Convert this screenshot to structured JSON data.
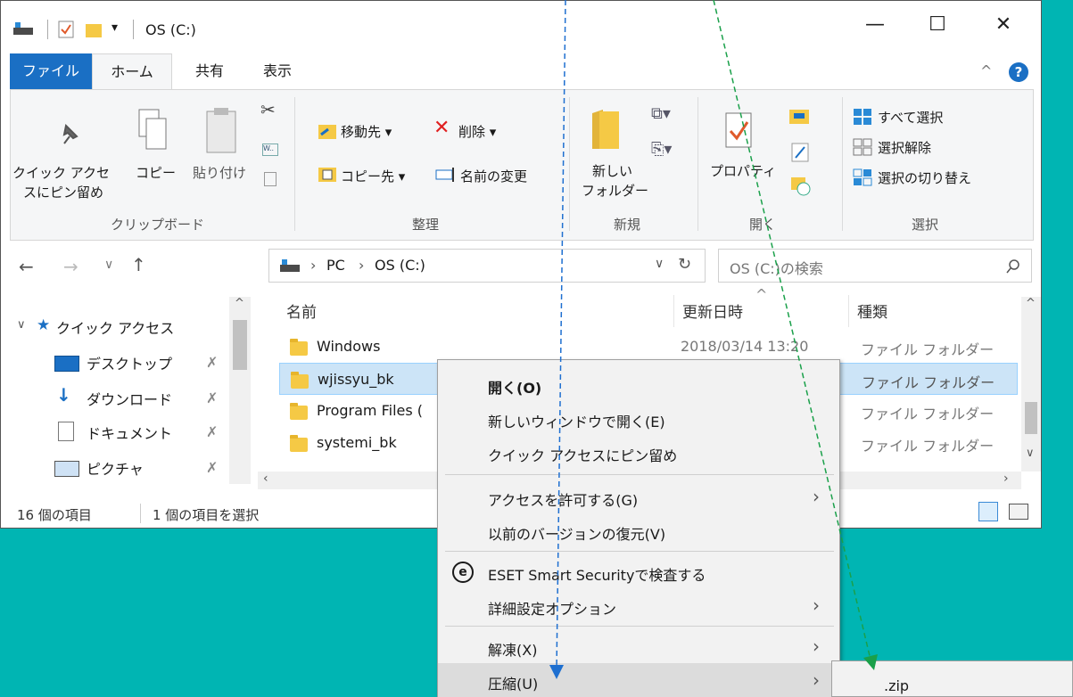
{
  "window": {
    "title": "OS (C:)",
    "minimize": "—",
    "maximize": "☐",
    "close": "✕"
  },
  "tabs": [
    {
      "label": "ファイル"
    },
    {
      "label": "ホーム"
    },
    {
      "label": "共有"
    },
    {
      "label": "表示"
    }
  ],
  "ribbon": {
    "clipboard": {
      "pin_line1": "クイック アクセ",
      "pin_line2": "スにピン留め",
      "copy": "コピー",
      "paste": "貼り付け",
      "group": "クリップボード"
    },
    "organize": {
      "move_to": "移動先 ▾",
      "delete": "削除 ▾",
      "copy_to": "コピー先 ▾",
      "rename": "名前の変更",
      "group": "整理"
    },
    "new": {
      "folder_line1": "新しい",
      "folder_line2": "フォルダー",
      "group": "新規"
    },
    "open": {
      "properties": "プロパティ",
      "group": "開く"
    },
    "select": {
      "all": "すべて選択",
      "none": "選択解除",
      "invert": "選択の切り替え",
      "group": "選択"
    }
  },
  "address": {
    "crumb_pc": "PC",
    "crumb_drive": "OS (C:)",
    "search_placeholder": "OS (C:)の検索"
  },
  "navpane": {
    "quick_access": "クイック アクセス",
    "items": [
      {
        "label": "デスクトップ"
      },
      {
        "label": "ダウンロード"
      },
      {
        "label": "ドキュメント"
      },
      {
        "label": "ピクチャ"
      }
    ]
  },
  "filelist": {
    "col_name": "名前",
    "col_date": "更新日時",
    "col_type": "種類",
    "rows": [
      {
        "name": "Windows",
        "date": "2018/03/14 13:20",
        "type": "ファイル フォルダー"
      },
      {
        "name": "wjissyu_bk",
        "date": "",
        "type": "ファイル フォルダー"
      },
      {
        "name": "Program Files (",
        "date": "",
        "type": "ファイル フォルダー"
      },
      {
        "name": "systemi_bk",
        "date": "",
        "type": "ファイル フォルダー"
      }
    ]
  },
  "status": {
    "count": "16 個の項目",
    "selected": "1 個の項目を選択"
  },
  "context_menu": {
    "items": [
      {
        "label": "開く(O)"
      },
      {
        "label": "新しいウィンドウで開く(E)"
      },
      {
        "label": "クイック アクセスにピン留め"
      },
      {
        "label": "アクセスを許可する(G)"
      },
      {
        "label": "以前のバージョンの復元(V)"
      },
      {
        "label": "ESET Smart Securityで検査する"
      },
      {
        "label": "詳細設定オプション"
      },
      {
        "label": "解凍(X)"
      },
      {
        "label": "圧縮(U)"
      }
    ],
    "submenu_zip": ".zip"
  },
  "colors": {
    "desktop": "#00b5b3",
    "accent": "#1a6fc4",
    "selection": "#cce4f7",
    "annot_blue": "#1e6fd0",
    "annot_green": "#1aa04a"
  }
}
